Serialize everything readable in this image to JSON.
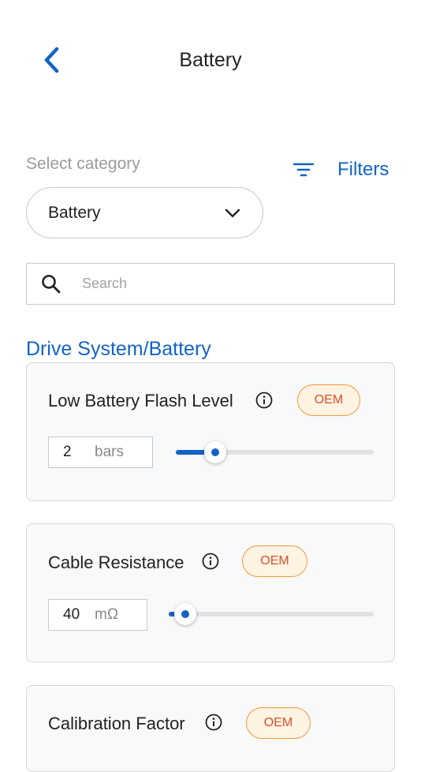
{
  "header": {
    "title": "Battery"
  },
  "category": {
    "label": "Select category",
    "selected": "Battery"
  },
  "filters": {
    "label": "Filters"
  },
  "search": {
    "placeholder": "Search"
  },
  "section": {
    "title": "Drive System/Battery"
  },
  "parameters": [
    {
      "title": "Low Battery Flash Level",
      "badge": "OEM",
      "value": "2",
      "unit": "bars",
      "slider_fraction": 0.2
    },
    {
      "title": "Cable Resistance",
      "badge": "OEM",
      "value": "40",
      "unit": "mΩ",
      "slider_fraction": 0.08
    },
    {
      "title": "Calibration Factor",
      "badge": "OEM"
    }
  ],
  "colors": {
    "accent": "#1263c6",
    "badge_border": "#f19a3a",
    "badge_text": "#d9502c",
    "badge_bg": "#fff3e3"
  },
  "icons": {
    "back": "chevron-left-icon",
    "filters": "filter-lines-icon",
    "dropdown": "chevron-down-icon",
    "search": "search-icon",
    "info": "info-circle-icon"
  }
}
